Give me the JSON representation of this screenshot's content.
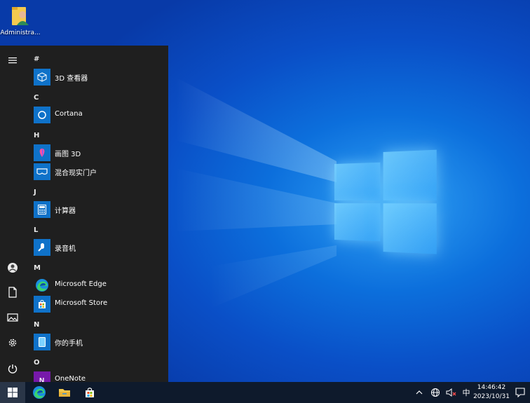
{
  "desktop": {
    "icons": [
      {
        "label": "Administra...",
        "icon": "user-folder-icon"
      }
    ]
  },
  "start_menu": {
    "rail": [
      {
        "icon": "hamburger-menu-icon"
      },
      {
        "icon": "user-account-icon"
      },
      {
        "icon": "documents-icon"
      },
      {
        "icon": "pictures-icon"
      },
      {
        "icon": "settings-gear-icon"
      },
      {
        "icon": "power-icon"
      }
    ],
    "sections": [
      {
        "letter": "#",
        "apps": [
          {
            "name": "3D 查看器",
            "icon": "3d-viewer-icon"
          }
        ]
      },
      {
        "letter": "C",
        "apps": [
          {
            "name": "Cortana",
            "icon": "cortana-icon"
          }
        ]
      },
      {
        "letter": "H",
        "apps": [
          {
            "name": "画图 3D",
            "icon": "paint-3d-icon"
          },
          {
            "name": "混合现实门户",
            "icon": "mixed-reality-icon"
          }
        ]
      },
      {
        "letter": "J",
        "apps": [
          {
            "name": "计算器",
            "icon": "calculator-icon"
          }
        ]
      },
      {
        "letter": "L",
        "apps": [
          {
            "name": "录音机",
            "icon": "voice-recorder-icon"
          }
        ]
      },
      {
        "letter": "M",
        "apps": [
          {
            "name": "Microsoft Edge",
            "icon": "edge-icon"
          },
          {
            "name": "Microsoft Store",
            "icon": "store-icon"
          }
        ]
      },
      {
        "letter": "N",
        "apps": [
          {
            "name": "你的手机",
            "icon": "your-phone-icon"
          }
        ]
      },
      {
        "letter": "O",
        "apps": [
          {
            "name": "OneNote",
            "icon": "onenote-icon"
          }
        ]
      }
    ]
  },
  "taskbar": {
    "pinned": [
      {
        "icon": "start-windows-icon"
      },
      {
        "icon": "edge-icon"
      },
      {
        "icon": "file-explorer-icon"
      },
      {
        "icon": "store-icon"
      }
    ],
    "tray": {
      "chevron": "^",
      "ime": "中",
      "time": "14:46:42",
      "date": "2023/10/31"
    }
  },
  "colors": {
    "accent": "#0f72c9",
    "menu_bg": "#1f1f1f",
    "taskbar_bg": "#0e1a2c"
  }
}
